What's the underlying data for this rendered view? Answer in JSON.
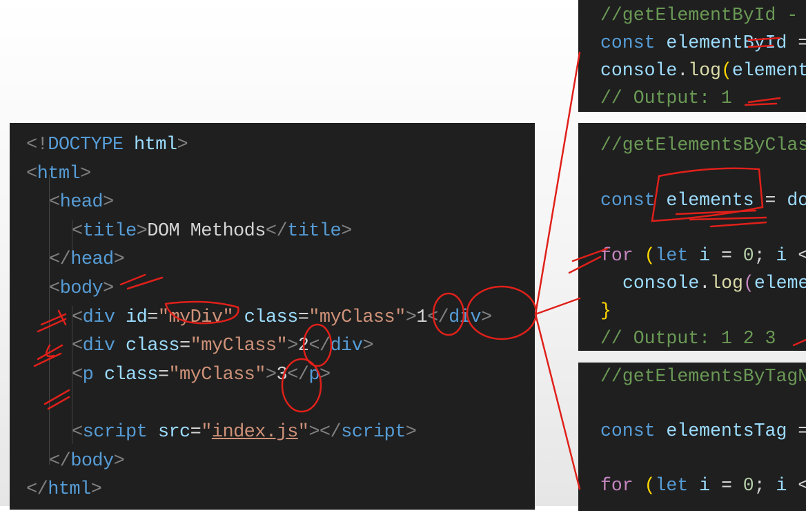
{
  "html_panel": {
    "lines": [
      {
        "indent": 0,
        "tokens": [
          [
            "<!",
            "ang"
          ],
          [
            "DOCTYPE",
            "kw"
          ],
          [
            " html",
            "attr"
          ],
          [
            ">",
            "ang"
          ]
        ]
      },
      {
        "indent": 0,
        "tokens": [
          [
            "<",
            "ang"
          ],
          [
            "html",
            "tag"
          ],
          [
            ">",
            "ang"
          ]
        ]
      },
      {
        "indent": 1,
        "tokens": [
          [
            "<",
            "ang"
          ],
          [
            "head",
            "tag"
          ],
          [
            ">",
            "ang"
          ]
        ]
      },
      {
        "indent": 2,
        "tokens": [
          [
            "<",
            "ang"
          ],
          [
            "title",
            "tag"
          ],
          [
            ">",
            "ang"
          ],
          [
            "DOM Methods",
            "txt"
          ],
          [
            "</",
            "ang"
          ],
          [
            "title",
            "tag"
          ],
          [
            ">",
            "ang"
          ]
        ]
      },
      {
        "indent": 1,
        "tokens": [
          [
            "</",
            "ang"
          ],
          [
            "head",
            "tag"
          ],
          [
            ">",
            "ang"
          ]
        ]
      },
      {
        "indent": 1,
        "tokens": [
          [
            "<",
            "ang"
          ],
          [
            "body",
            "tag"
          ],
          [
            ">",
            "ang"
          ]
        ]
      },
      {
        "indent": 2,
        "tokens": [
          [
            "<",
            "ang"
          ],
          [
            "div",
            "tag"
          ],
          [
            " id",
            "attr"
          ],
          [
            "=",
            "txt"
          ],
          [
            "\"myDiv\"",
            "str"
          ],
          [
            " class",
            "attr"
          ],
          [
            "=",
            "txt"
          ],
          [
            "\"myClass\"",
            "str"
          ],
          [
            ">",
            "ang"
          ],
          [
            "1",
            "txt"
          ],
          [
            "</",
            "ang"
          ],
          [
            "div",
            "tag"
          ],
          [
            ">",
            "ang"
          ]
        ]
      },
      {
        "indent": 2,
        "tokens": [
          [
            "<",
            "ang"
          ],
          [
            "div",
            "tag"
          ],
          [
            " class",
            "attr"
          ],
          [
            "=",
            "txt"
          ],
          [
            "\"myClass\"",
            "str"
          ],
          [
            ">",
            "ang"
          ],
          [
            "2",
            "txt"
          ],
          [
            "</",
            "ang"
          ],
          [
            "div",
            "tag"
          ],
          [
            ">",
            "ang"
          ]
        ]
      },
      {
        "indent": 2,
        "tokens": [
          [
            "<",
            "ang"
          ],
          [
            "p",
            "tag"
          ],
          [
            " class",
            "attr"
          ],
          [
            "=",
            "txt"
          ],
          [
            "\"myClass\"",
            "str"
          ],
          [
            ">",
            "ang"
          ],
          [
            "3",
            "txt"
          ],
          [
            "</",
            "ang"
          ],
          [
            "p",
            "tag"
          ],
          [
            ">",
            "ang"
          ]
        ]
      },
      {
        "indent": 2,
        "tokens": []
      },
      {
        "indent": 2,
        "tokens": [
          [
            "<",
            "ang"
          ],
          [
            "script",
            "tag"
          ],
          [
            " src",
            "attr"
          ],
          [
            "=",
            "txt"
          ],
          [
            "\"",
            "str"
          ],
          [
            "index.js",
            "link"
          ],
          [
            "\"",
            "str"
          ],
          [
            "></",
            "ang"
          ],
          [
            "script",
            "tag"
          ],
          [
            ">",
            "ang"
          ]
        ]
      },
      {
        "indent": 1,
        "tokens": [
          [
            "</",
            "ang"
          ],
          [
            "body",
            "tag"
          ],
          [
            ">",
            "ang"
          ]
        ]
      },
      {
        "indent": 0,
        "tokens": [
          [
            "</",
            "ang"
          ],
          [
            "html",
            "tag"
          ],
          [
            ">",
            "ang"
          ]
        ]
      }
    ]
  },
  "snippet_by_id": {
    "lines": [
      {
        "indent": 0,
        "tokens": [
          [
            "//getElementById - ",
            "com"
          ]
        ]
      },
      {
        "indent": 0,
        "tokens": [
          [
            "const",
            "kw"
          ],
          [
            " elementById",
            "var"
          ],
          [
            " =",
            "txt"
          ]
        ]
      },
      {
        "indent": 0,
        "tokens": [
          [
            "console",
            "var"
          ],
          [
            ".",
            "txt"
          ],
          [
            "log",
            "fn"
          ],
          [
            "(",
            "par"
          ],
          [
            "element",
            "var"
          ]
        ]
      },
      {
        "indent": 0,
        "tokens": [
          [
            "// Output: 1",
            "com"
          ]
        ]
      }
    ]
  },
  "snippet_by_class": {
    "lines": [
      {
        "indent": 0,
        "tokens": [
          [
            "//getElementsByClas",
            "com"
          ]
        ]
      },
      {
        "indent": 0,
        "tokens": []
      },
      {
        "indent": 0,
        "tokens": [
          [
            "const",
            "kw"
          ],
          [
            " elements",
            "var"
          ],
          [
            " = ",
            "txt"
          ],
          [
            "do",
            "var"
          ]
        ]
      },
      {
        "indent": 0,
        "tokens": []
      },
      {
        "indent": 0,
        "tokens": [
          [
            "for",
            "for"
          ],
          [
            " ",
            "txt"
          ],
          [
            "(",
            "par"
          ],
          [
            "let",
            "kw"
          ],
          [
            " i",
            "var"
          ],
          [
            " = ",
            "txt"
          ],
          [
            "0",
            "num"
          ],
          [
            "; ",
            "txt"
          ],
          [
            "i",
            "var"
          ],
          [
            " <",
            "txt"
          ]
        ]
      },
      {
        "indent": 1,
        "tokens": [
          [
            "console",
            "var"
          ],
          [
            ".",
            "txt"
          ],
          [
            "log",
            "fn"
          ],
          [
            "(",
            "for"
          ],
          [
            "eleme",
            "var"
          ]
        ]
      },
      {
        "indent": 0,
        "tokens": [
          [
            "}",
            "par"
          ]
        ]
      },
      {
        "indent": 0,
        "tokens": [
          [
            "// Output: 1 2 3",
            "com"
          ]
        ]
      }
    ]
  },
  "snippet_by_tag": {
    "lines": [
      {
        "indent": 0,
        "tokens": [
          [
            "//getElementsByTagN",
            "com"
          ]
        ]
      },
      {
        "indent": 0,
        "tokens": []
      },
      {
        "indent": 0,
        "tokens": [
          [
            "const",
            "kw"
          ],
          [
            " elementsTag",
            "var"
          ],
          [
            " =",
            "txt"
          ]
        ]
      },
      {
        "indent": 0,
        "tokens": []
      },
      {
        "indent": 0,
        "tokens": [
          [
            "for",
            "for"
          ],
          [
            " ",
            "txt"
          ],
          [
            "(",
            "par"
          ],
          [
            "let",
            "kw"
          ],
          [
            " i",
            "var"
          ],
          [
            " = ",
            "txt"
          ],
          [
            "0",
            "num"
          ],
          [
            "; ",
            "txt"
          ],
          [
            "i",
            "var"
          ],
          [
            " <",
            "txt"
          ]
        ]
      }
    ]
  },
  "colors": {
    "annotation": "#e0201a",
    "editor_bg": "#1f1f1f"
  }
}
